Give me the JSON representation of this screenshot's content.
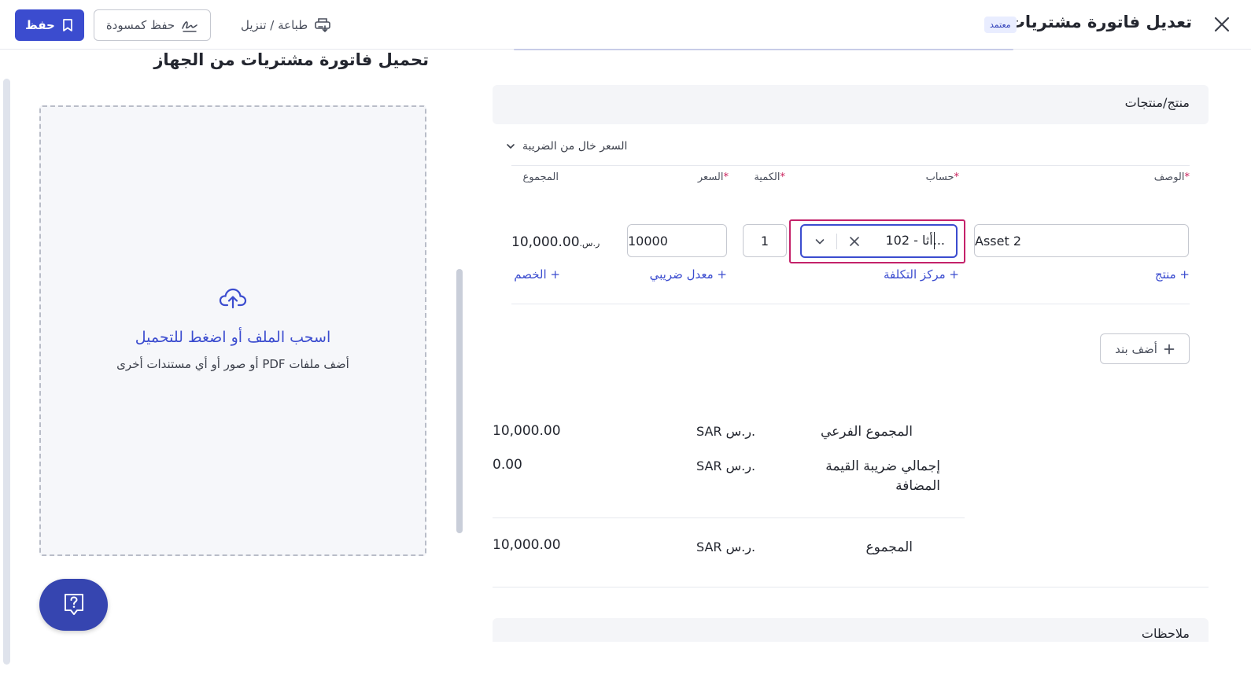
{
  "header": {
    "title": "تعديل فاتورة مشتريات",
    "status_badge": "معتمد",
    "print_label": "طباعة / تنزيل",
    "draft_label": "حفظ كمسودة",
    "save_label": "حفظ"
  },
  "upload": {
    "title": "تحميل فاتورة مشتريات من الجهاز",
    "main_text": "اسحب الملف أو اضغط للتحميل",
    "sub_text": "أضف ملفات PDF أو صور أو أي مستندات أخرى"
  },
  "products": {
    "section_title": "منتج/منتجات",
    "tax_mode_label": "السعر خال من الضريبة",
    "columns": {
      "description": "الوصف",
      "account": "حساب",
      "quantity": "الكمية",
      "price": "السعر",
      "total": "المجموع"
    },
    "required_mark": "*",
    "line": {
      "description": "Asset 2",
      "account": "102 - أثا...",
      "quantity": "1",
      "price": "10000",
      "total": "10,000.00",
      "total_currency": "ر.س."
    },
    "links": {
      "product": "+ منتج",
      "cost_center": "+ مركز التكلفة",
      "tax_rate": "+ معدل ضريبي",
      "discount": "+ الخصم"
    },
    "add_line_label": "أضف بند"
  },
  "summary": {
    "rows": [
      {
        "label": "المجموع الفرعي",
        "currency": "SAR ر.س.",
        "amount": "10,000.00"
      },
      {
        "label": "إجمالي ضريبة القيمة المضافة",
        "currency": "SAR ر.س.",
        "amount": "0.00"
      },
      {
        "label": "المجموع",
        "currency": "SAR ر.س.",
        "amount": "10,000.00"
      }
    ]
  },
  "notes": {
    "title": "ملاحظات"
  },
  "icons": {
    "close": "close-icon",
    "print": "printer-download-icon",
    "draft": "signature-icon",
    "save": "bookmark-icon",
    "upload": "cloud-upload-icon",
    "help": "help-chat-icon",
    "chevron": "chevron-down-icon",
    "clear": "x-icon",
    "add": "plus-icon"
  },
  "colors": {
    "primary": "#3b4ccf",
    "highlight": "#c4226a",
    "required": "#c81e5a",
    "fab": "#3645b0"
  }
}
